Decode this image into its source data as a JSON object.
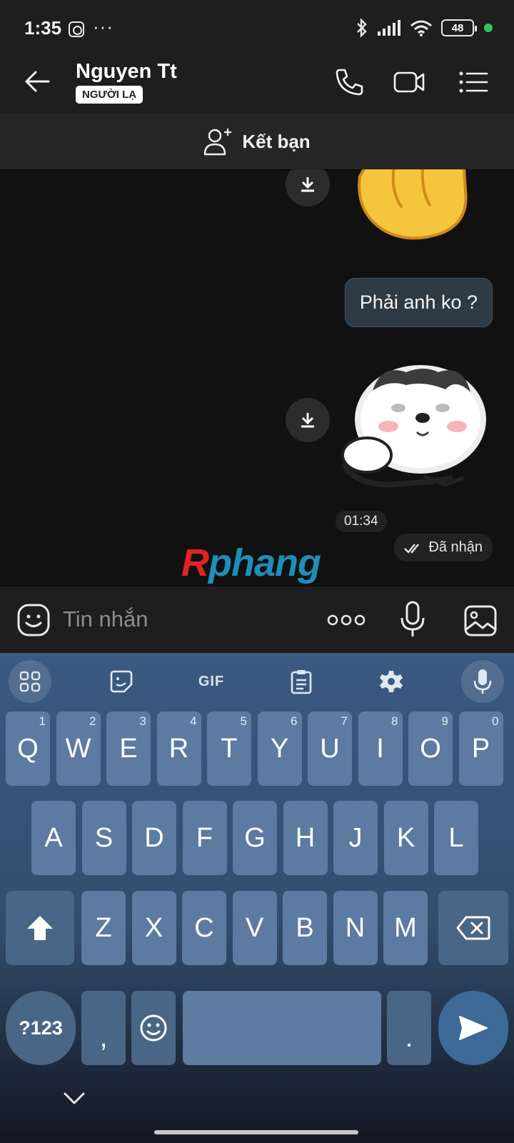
{
  "status_bar": {
    "time": "1:35",
    "extra": "···",
    "battery": "48"
  },
  "header": {
    "title": "Nguyen Tt",
    "badge": "NGƯỜI LẠ"
  },
  "add_friend": {
    "label": "Kết bạn"
  },
  "messages": {
    "text_bubble": "Phải anh ko ?",
    "time": "01:34",
    "status": "Đã nhận"
  },
  "watermark": {
    "first": "R",
    "rest": "phang"
  },
  "input": {
    "placeholder": "Tin nhắn"
  },
  "keyboard": {
    "toolbar": [
      "apps-grid-icon",
      "sticker-icon",
      "GIF",
      "clipboard-icon",
      "settings-icon",
      "voice-input-icon"
    ],
    "gif_label": "GIF",
    "row1": [
      {
        "k": "Q",
        "n": "1"
      },
      {
        "k": "W",
        "n": "2"
      },
      {
        "k": "E",
        "n": "3"
      },
      {
        "k": "R",
        "n": "4"
      },
      {
        "k": "T",
        "n": "5"
      },
      {
        "k": "Y",
        "n": "6"
      },
      {
        "k": "U",
        "n": "7"
      },
      {
        "k": "I",
        "n": "8"
      },
      {
        "k": "O",
        "n": "9"
      },
      {
        "k": "P",
        "n": "0"
      }
    ],
    "row2": [
      "A",
      "S",
      "D",
      "F",
      "G",
      "H",
      "J",
      "K",
      "L"
    ],
    "row3": [
      "Z",
      "X",
      "C",
      "V",
      "B",
      "N",
      "M"
    ],
    "symbols_label": "?123",
    "comma": ",",
    "period": "."
  },
  "colors": {
    "accent": "#3d6a97",
    "bubble": "#2e3a44",
    "key": "#5d7ba1",
    "online": "#2fc85a"
  }
}
